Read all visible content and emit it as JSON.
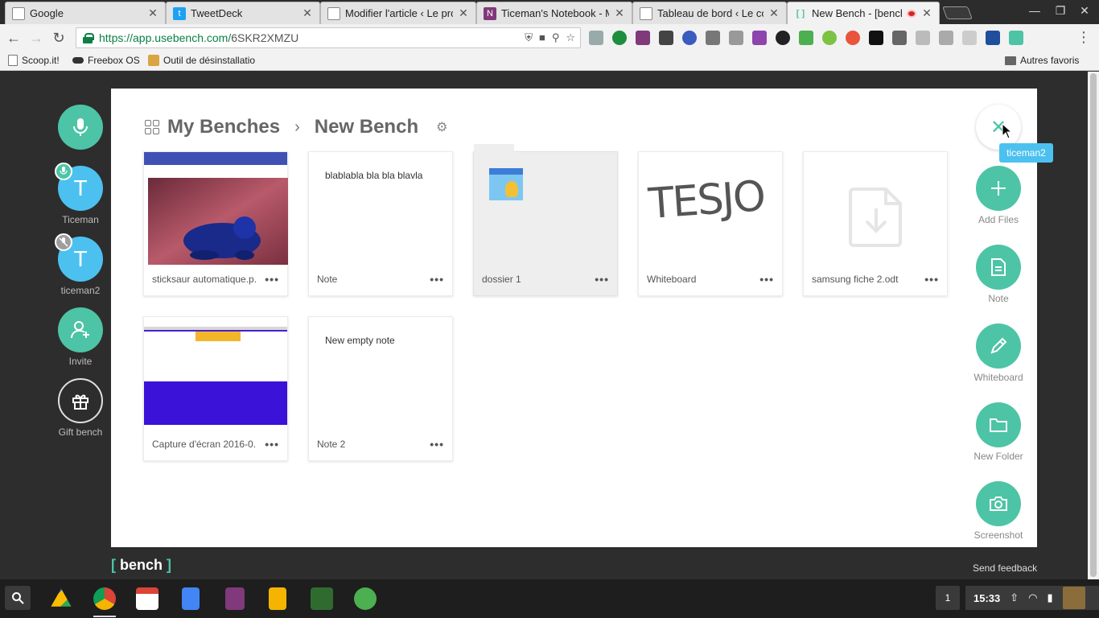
{
  "browser": {
    "tabs": [
      {
        "title": "Google",
        "icon": "page-icon"
      },
      {
        "title": "TweetDeck",
        "icon": "twitter-icon"
      },
      {
        "title": "Modifier l'article ‹ Le prop",
        "icon": "page-icon"
      },
      {
        "title": "Ticeman's Notebook - M",
        "icon": "onenote-icon"
      },
      {
        "title": "Tableau de bord ‹ Le cou",
        "icon": "page-icon"
      },
      {
        "title": "New Bench - [bench]",
        "icon": "bench-icon"
      }
    ],
    "url_scheme": "https://app.usebench.com/",
    "url_path": "6SKR2XMZU",
    "bookmarks": [
      "Scoop.it!",
      "Freebox OS",
      "Outil de désinstallatio",
      "Autres favoris"
    ]
  },
  "app": {
    "breadcrumb": {
      "root": "My Benches",
      "separator": "›",
      "current": "New Bench"
    },
    "left_bar": {
      "users": [
        {
          "initial": "T",
          "name": "Ticeman"
        },
        {
          "initial": "T",
          "name": "ticeman2"
        }
      ],
      "invite_label": "Invite",
      "gift_label": "Gift bench"
    },
    "cards": [
      {
        "name": "sticksaur automatique.p...",
        "kind": "image"
      },
      {
        "name": "Note",
        "kind": "note",
        "text": "blablabla bla bla blavla"
      },
      {
        "name": "dossier 1",
        "kind": "folder"
      },
      {
        "name": "Whiteboard",
        "kind": "whiteboard",
        "drawing": "TESJO"
      },
      {
        "name": "samsung fiche 2.odt",
        "kind": "file"
      },
      {
        "name": "Capture d'écran 2016-0...",
        "kind": "screenshot"
      },
      {
        "name": "Note 2",
        "kind": "note",
        "text": "New empty note"
      }
    ],
    "card_menu": "•••",
    "right_bar": {
      "tooltip": "ticeman2",
      "actions": [
        "Add Files",
        "Note",
        "Whiteboard",
        "New Folder",
        "Screenshot"
      ]
    },
    "logo": {
      "open": "[",
      "word": "bench",
      "close": "]"
    },
    "feedback": "Send feedback",
    "colors": {
      "accent": "#4dc4a5",
      "user": "#4cc1f0",
      "background": "#2d2d2d"
    }
  },
  "taskbar": {
    "window_count": "1",
    "time": "15:33"
  }
}
